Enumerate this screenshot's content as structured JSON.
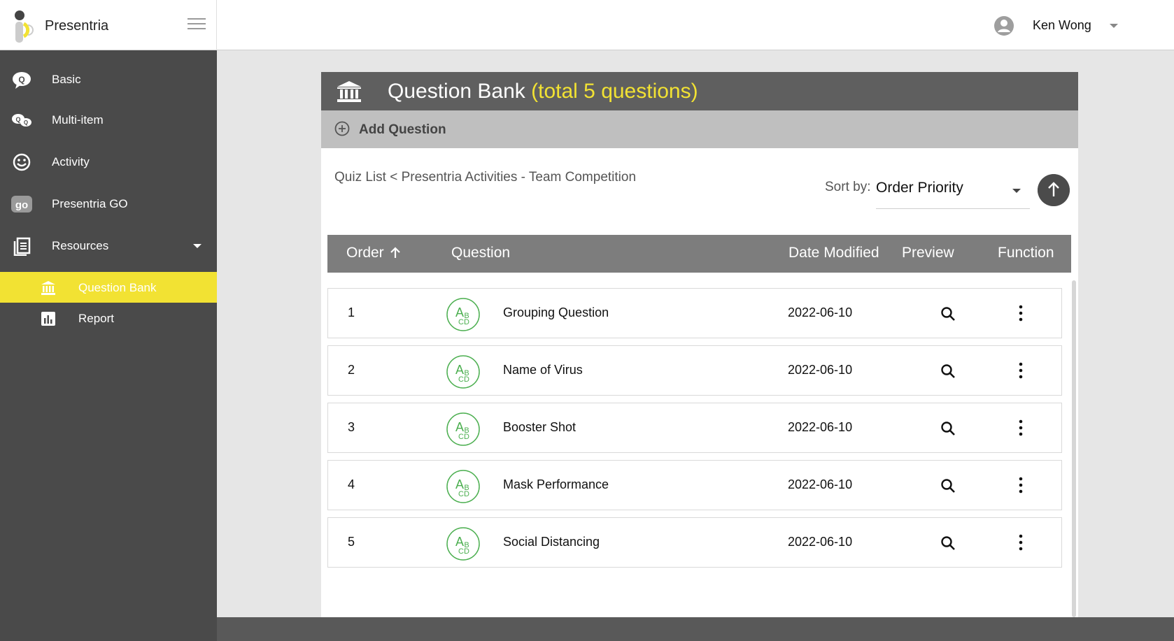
{
  "app": {
    "brand_name": "Presentria",
    "user_name": "Ken Wong"
  },
  "sidebar": {
    "items": [
      {
        "label": "Basic",
        "icon": "question-bubble-icon"
      },
      {
        "label": "Multi-item",
        "icon": "multi-bubble-icon"
      },
      {
        "label": "Activity",
        "icon": "smiley-icon"
      },
      {
        "label": "Presentria GO",
        "icon": "go-icon"
      },
      {
        "label": "Resources",
        "icon": "resources-icon"
      }
    ],
    "sub_items": [
      {
        "label": "Question Bank",
        "icon": "bank-icon",
        "active": true
      },
      {
        "label": "Report",
        "icon": "report-chart-icon",
        "active": false
      }
    ],
    "active_color": "#f2e233"
  },
  "panel": {
    "title": "Question Bank",
    "count_text": "(total 5 questions)",
    "add_label": "Add Question",
    "breadcrumb": "Quiz List < Presentria Activities - Team Competition",
    "sort_label": "Sort by:",
    "sort_value": "Order Priority"
  },
  "table": {
    "headers": {
      "order": "Order",
      "question": "Question",
      "date": "Date Modified",
      "preview": "Preview",
      "function": "Function"
    },
    "type_icon_glyphs": {
      "a": "A",
      "b": "B",
      "cd": "CD"
    },
    "type_icon_color": "#4caf50",
    "rows": [
      {
        "order": "1",
        "title": "Grouping Question",
        "date": "2022-06-10"
      },
      {
        "order": "2",
        "title": "Name of Virus",
        "date": "2022-06-10"
      },
      {
        "order": "3",
        "title": "Booster Shot",
        "date": "2022-06-10"
      },
      {
        "order": "4",
        "title": "Mask Performance",
        "date": "2022-06-10"
      },
      {
        "order": "5",
        "title": "Social Distancing",
        "date": "2022-06-10"
      }
    ]
  }
}
